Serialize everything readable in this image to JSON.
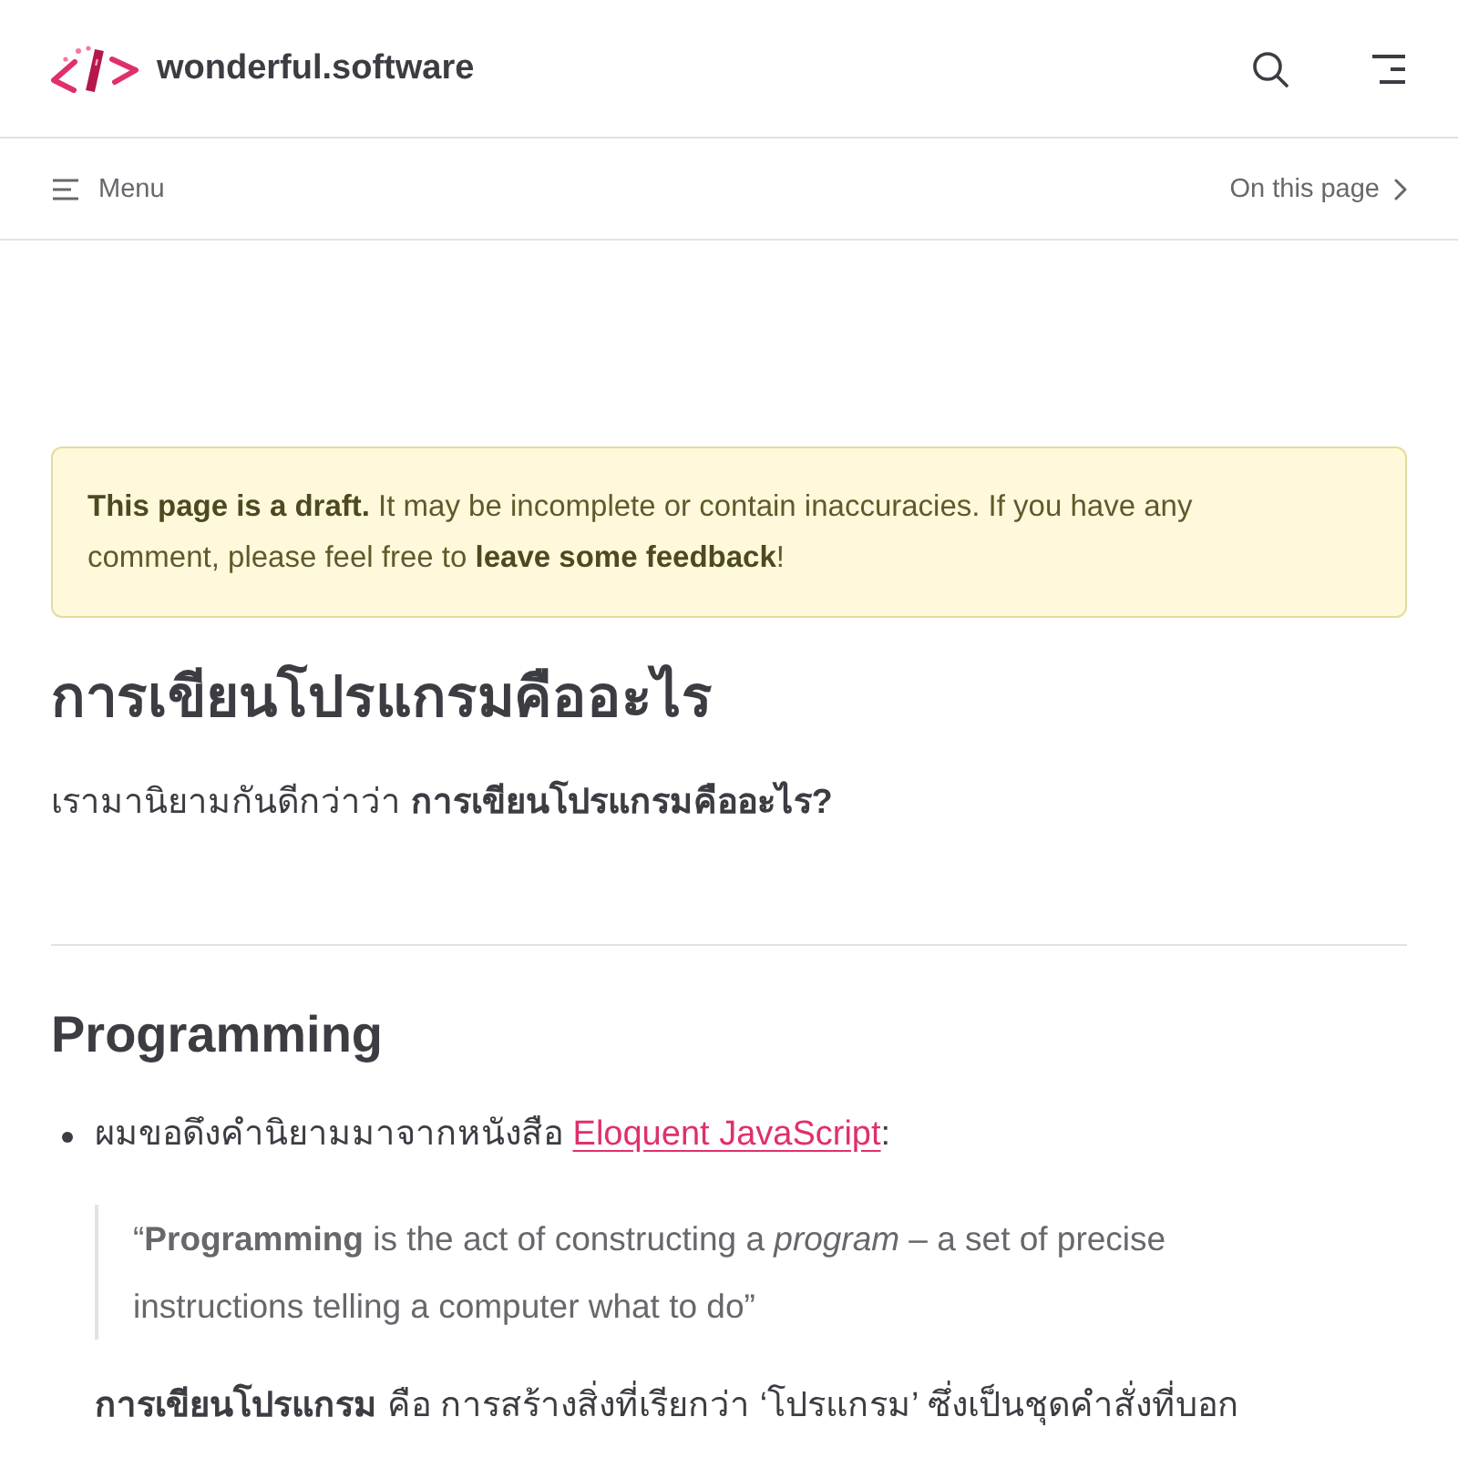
{
  "header": {
    "site_name": "wonderful.software"
  },
  "subbar": {
    "menu_label": "Menu",
    "toc_label": "On this page"
  },
  "notice": {
    "text": "**This page is a draft.** It may be incomplete or contain inaccuracies. If you have any comment, please feel free to **leave some feedback**!"
  },
  "article": {
    "title": "การเขียนโปรแกรมคืออะไร",
    "intro": "เรามานิยามกันดีกว่าว่า **การเขียนโปรแกรมคืออะไร?**",
    "sections": [
      {
        "heading": "Programming",
        "items": [
          {
            "text": "ผมขอดึงคำนิยามมาจากหนังสือ",
            "link": "Eloquent JavaScript",
            "after": ":",
            "quote": "“**Programming** is the act of constructing a *program* – a set of precise instructions telling a computer what to do”",
            "paragraphs": [
              "**การเขียนโปรแกรม** คือ การสร้างสิ่งที่เรียกว่า ‘โปรแกรม’ ซึ่งเป็นชุดคำสั่งที่บอก"
            ]
          }
        ]
      }
    ]
  }
}
